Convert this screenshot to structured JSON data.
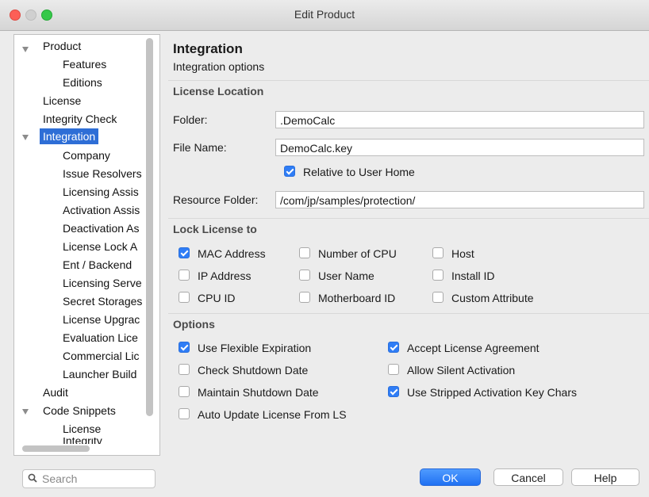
{
  "window": {
    "title": "Edit Product"
  },
  "tree": {
    "items": [
      {
        "label": "Product",
        "expanded": true
      },
      {
        "label": "Features"
      },
      {
        "label": "Editions"
      },
      {
        "label": "License"
      },
      {
        "label": "Integrity Check"
      },
      {
        "label": "Integration",
        "expanded": true,
        "selected": true
      },
      {
        "label": "Company"
      },
      {
        "label": "Issue Resolvers"
      },
      {
        "label": "Licensing Assis"
      },
      {
        "label": "Activation Assis"
      },
      {
        "label": "Deactivation As"
      },
      {
        "label": "License Lock A"
      },
      {
        "label": "Ent / Backend"
      },
      {
        "label": "Licensing Serve"
      },
      {
        "label": "Secret Storages"
      },
      {
        "label": "License Upgrac"
      },
      {
        "label": "Evaluation Lice"
      },
      {
        "label": "Commercial Lic"
      },
      {
        "label": "Launcher Build"
      },
      {
        "label": "Audit"
      },
      {
        "label": "Code Snippets",
        "expanded": true
      },
      {
        "label": "License"
      },
      {
        "label": "Integrity"
      }
    ]
  },
  "search": {
    "placeholder": "Search"
  },
  "panel": {
    "title": "Integration",
    "subtitle": "Integration options",
    "license_location": {
      "heading": "License Location",
      "folder_label": "Folder:",
      "folder_value": ".DemoCalc",
      "filename_label": "File Name:",
      "filename_value": "DemoCalc.key",
      "relative_label": "Relative to User Home",
      "relative_checked": true,
      "resource_label": "Resource Folder:",
      "resource_value": "/com/jp/samples/protection/"
    },
    "lock": {
      "heading": "Lock License to",
      "mac": "MAC Address",
      "cpus": "Number of CPU",
      "host": "Host",
      "ip": "IP Address",
      "user": "User Name",
      "install": "Install ID",
      "cpuid": "CPU ID",
      "mobo": "Motherboard ID",
      "custom": "Custom Attribute"
    },
    "options": {
      "heading": "Options",
      "flex": "Use Flexible Expiration",
      "accept": "Accept License Agreement",
      "check_shutdown": "Check Shutdown Date",
      "silent": "Allow Silent Activation",
      "maintain_shutdown": "Maintain Shutdown Date",
      "stripped": "Use Stripped Activation Key Chars",
      "auto_update": "Auto Update License From LS"
    }
  },
  "buttons": {
    "ok": "OK",
    "cancel": "Cancel",
    "help": "Help"
  },
  "colors": {
    "accent": "#2f7df6",
    "selection": "#2e6ed6"
  }
}
